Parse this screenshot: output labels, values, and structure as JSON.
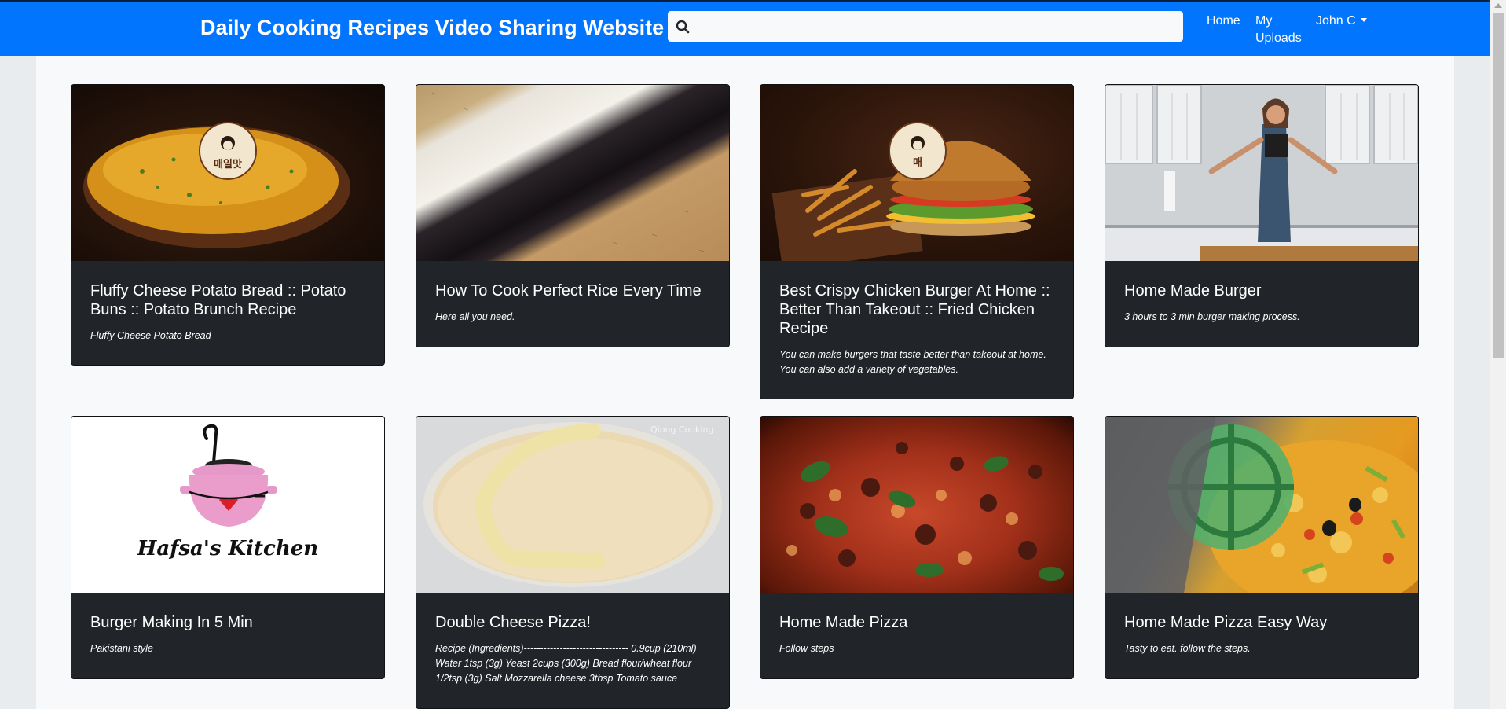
{
  "header": {
    "brand": "Daily Cooking Recipes Video Sharing Website",
    "search_placeholder": "",
    "nav": {
      "home": "Home",
      "uploads_line1": "My",
      "uploads_line2": "Uploads",
      "user": "John C"
    }
  },
  "videos": [
    {
      "title": "Fluffy Cheese Potato Bread :: Potato Buns :: Potato Brunch Recipe",
      "description": "Fluffy Cheese Potato Bread",
      "badge": "매일맛"
    },
    {
      "title": "How To Cook Perfect Rice Every Time",
      "description": "Here all you need."
    },
    {
      "title": "Best Crispy Chicken Burger At Home :: Better Than Takeout :: Fried Chicken Recipe",
      "description": "You can make burgers that taste better than takeout at home. You can also add a variety of vegetables.",
      "badge": "매"
    },
    {
      "title": "Home Made Burger",
      "description": "3 hours to 3 min burger making process."
    },
    {
      "title": "Burger Making In 5 Min",
      "description": "Pakistani style",
      "logo_text": "Hafsa's Kitchen"
    },
    {
      "title": "Double Cheese Pizza!",
      "description": "Recipe (Ingredients)-------------------------------- 0.9cup (210ml) Water 1tsp (3g) Yeast 2cups (300g) Bread flour/wheat flour 1/2tsp (3g) Salt Mozzarella cheese 3tbsp Tomato sauce",
      "watermark": "Qiong Cooking"
    },
    {
      "title": "Home Made Pizza",
      "description": "Follow steps"
    },
    {
      "title": "Home Made Pizza Easy Way",
      "description": "Tasty to eat. follow the steps."
    }
  ],
  "colors": {
    "navbar": "#0275ff",
    "card_bg": "#212529",
    "page_bg": "#f8f9fa"
  }
}
